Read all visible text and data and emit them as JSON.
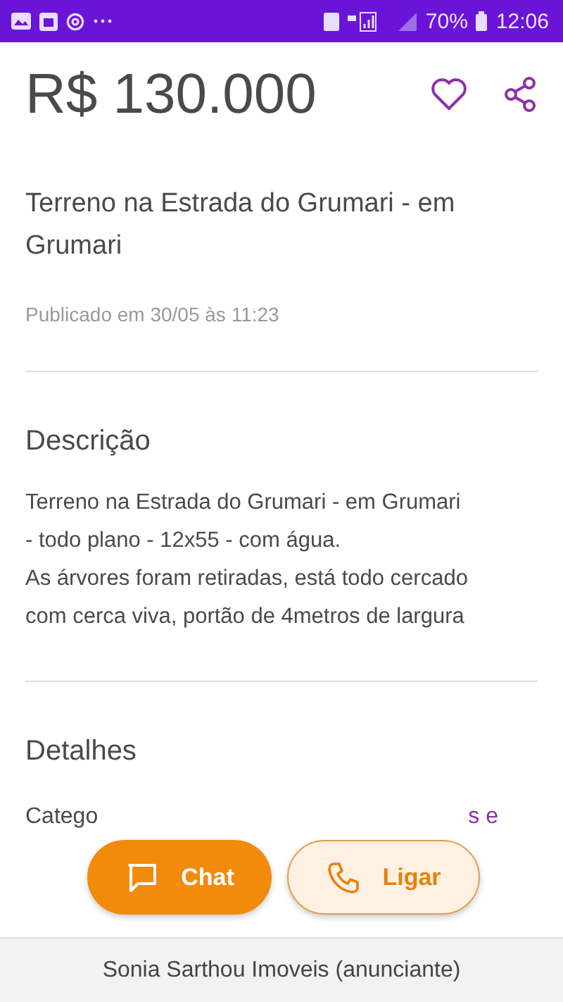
{
  "status_bar": {
    "battery": "70%",
    "time": "12:06"
  },
  "listing": {
    "price": "R$ 130.000",
    "favorite": false,
    "title": "Terreno na Estrada do Grumari - em Grumari",
    "published": "Publicado em 30/05 às 11:23"
  },
  "description": {
    "heading": "Descrição",
    "lines": [
      "Terreno na Estrada do Grumari - em Grumari",
      "- todo plano - 12x55 - com água.",
      "As árvores foram retiradas, está todo cercado",
      "com cerca viva, portão de 4metros de largura"
    ]
  },
  "details": {
    "heading": "Detalhes",
    "rows": [
      {
        "label": "Catego",
        "value": "s e"
      }
    ]
  },
  "actions": [
    {
      "kind": "chat",
      "label": "Chat"
    },
    {
      "kind": "call",
      "label": "Ligar"
    }
  ],
  "footer": {
    "advertiser": "Sonia Sarthou Imoveis (anunciante)"
  }
}
